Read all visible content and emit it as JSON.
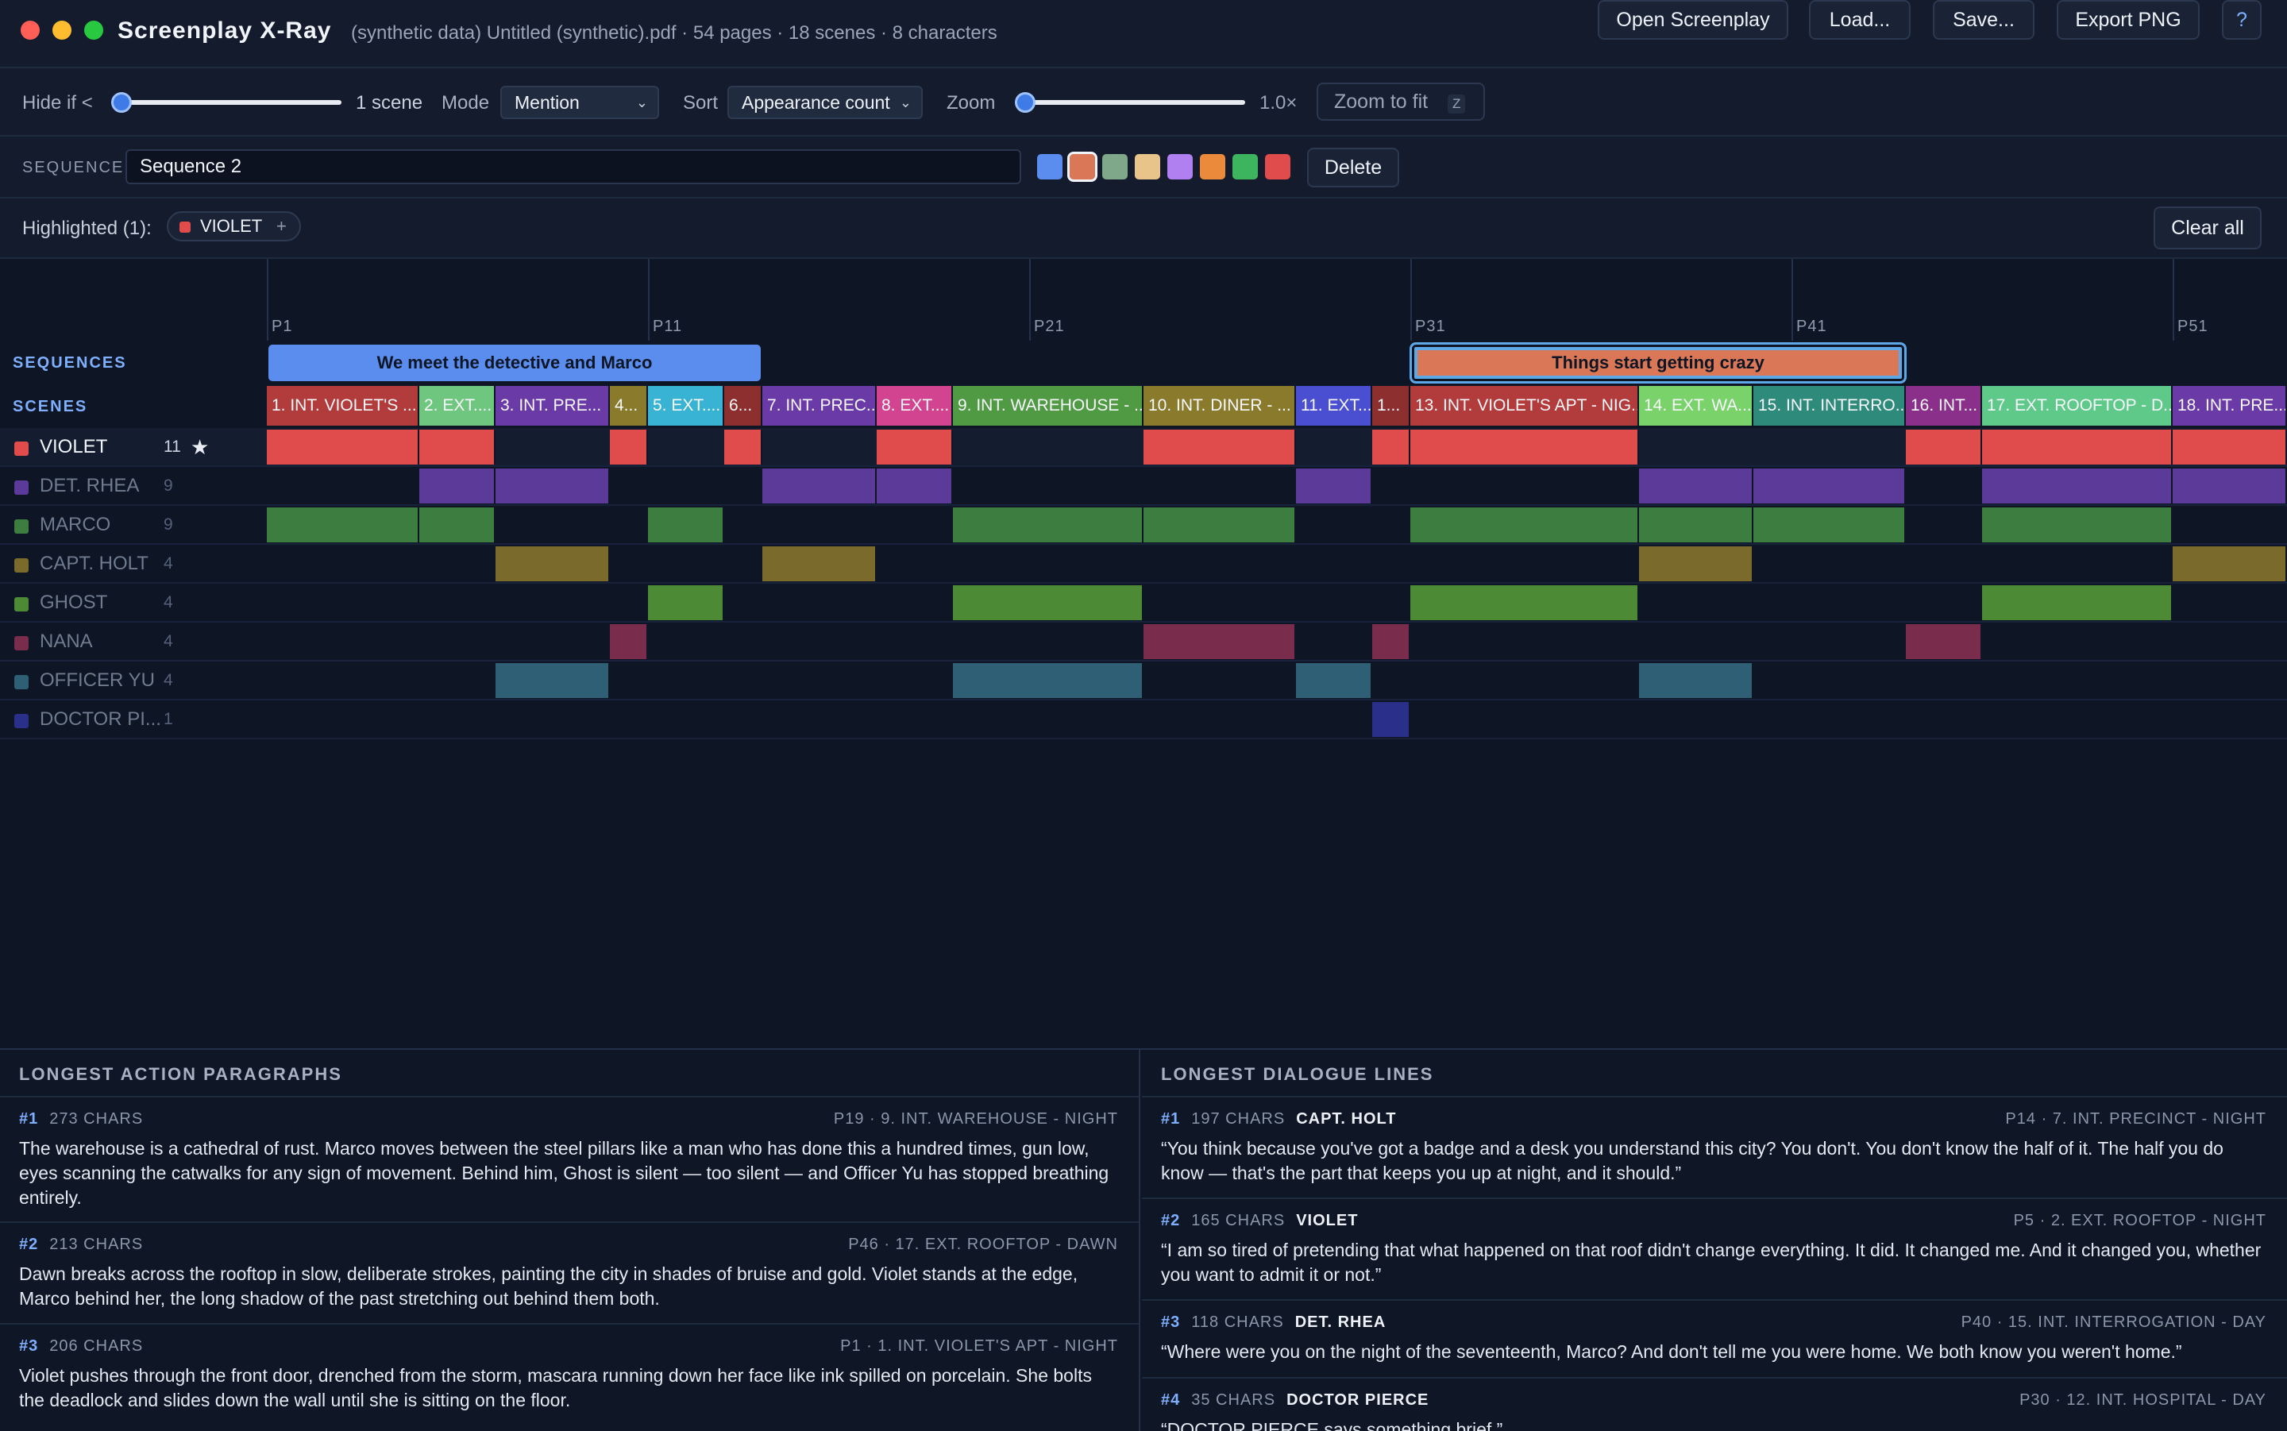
{
  "app": {
    "title": "Screenplay X-Ray",
    "file_info": "(synthetic data) Untitled (synthetic).pdf · 54 pages · 18 scenes · 8 characters"
  },
  "toolbar": {
    "open": "Open Screenplay",
    "load": "Load...",
    "save": "Save...",
    "export": "Export PNG",
    "help": "?"
  },
  "controls": {
    "hide_label": "Hide if <",
    "hide_value": "1 scene",
    "mode_label": "Mode",
    "mode_value": "Mention",
    "sort_label": "Sort",
    "sort_value": "Appearance count",
    "zoom_label": "Zoom",
    "zoom_value": "1.0×",
    "zoom_fit": "Zoom to fit",
    "zoom_fit_key": "Z"
  },
  "sequence_editor": {
    "label": "SEQUENCE",
    "name": "Sequence 2",
    "delete": "Delete",
    "swatches": [
      "#5b8def",
      "#d97757",
      "#7fa88a",
      "#e9c48a",
      "#b07ff0",
      "#ea8a3a",
      "#3db55e",
      "#e04b4b"
    ],
    "selected_swatch": 1
  },
  "highlight": {
    "label": "Highlighted (1):",
    "chip": "VIOLET",
    "chip_color": "#e04b4b",
    "add": "+",
    "clear": "Clear all"
  },
  "timeline": {
    "page_ticks": [
      "P1",
      "P11",
      "P21",
      "P31",
      "P41",
      "P51"
    ],
    "sequences_label": "SEQUENCES",
    "scenes_label": "SCENES",
    "sequences": [
      {
        "label": "We meet the detective and Marco",
        "color": "#5b8def",
        "scene_start": 1,
        "scene_end": 6
      },
      {
        "label": "Things start getting crazy",
        "color": "#d97757",
        "scene_start": 13,
        "scene_end": 15
      }
    ],
    "scenes": [
      {
        "label": "1. INT. VIOLET'S ...",
        "color": "#b23b3b",
        "w": 2
      },
      {
        "label": "2. EXT....",
        "color": "#6fc67e",
        "w": 1
      },
      {
        "label": "3. INT. PRE...",
        "color": "#6a3aa6",
        "w": 1.5
      },
      {
        "label": "4...",
        "color": "#8a7a2c",
        "w": 0.5
      },
      {
        "label": "5. EXT....",
        "color": "#39b3d3",
        "w": 1
      },
      {
        "label": "6...",
        "color": "#8e2f2f",
        "w": 0.5
      },
      {
        "label": "7. INT. PREC...",
        "color": "#6a3aa6",
        "w": 1.5
      },
      {
        "label": "8. EXT....",
        "color": "#d2448f",
        "w": 1
      },
      {
        "label": "9. INT. WAREHOUSE - ...",
        "color": "#4f9a42",
        "w": 2.5
      },
      {
        "label": "10. INT. DINER - ...",
        "color": "#8a7a2c",
        "w": 2
      },
      {
        "label": "11. EXT....",
        "color": "#4a4fd2",
        "w": 1
      },
      {
        "label": "1...",
        "color": "#8e2f2f",
        "w": 0.5
      },
      {
        "label": "13. INT. VIOLET'S APT - NIG...",
        "color": "#b23b3b",
        "w": 3
      },
      {
        "label": "14. EXT. WA...",
        "color": "#7ad36a",
        "w": 1.5
      },
      {
        "label": "15. INT. INTERRO...",
        "color": "#2e8a7a",
        "w": 2
      },
      {
        "label": "16. INT...",
        "color": "#8a2f8a",
        "w": 1
      },
      {
        "label": "17. EXT. ROOFTOP - D...",
        "color": "#5fc98a",
        "w": 2.5
      },
      {
        "label": "18. INT. PRE...",
        "color": "#6a3aa6",
        "w": 1.5
      }
    ],
    "characters": [
      {
        "name": "VIOLET",
        "count": "11",
        "color": "#e04b4b",
        "star": "★",
        "highlighted": true,
        "scenes": [
          0,
          1,
          3,
          5,
          7,
          9,
          11,
          12,
          15,
          16,
          17
        ]
      },
      {
        "name": "DET. RHEA",
        "count": "9",
        "color": "#5b3a9a",
        "scenes": [
          1,
          2,
          6,
          7,
          10,
          13,
          14,
          16,
          17
        ]
      },
      {
        "name": "MARCO",
        "count": "9",
        "color": "#3d7d3f",
        "scenes": [
          0,
          1,
          4,
          8,
          9,
          12,
          13,
          14,
          16
        ]
      },
      {
        "name": "CAPT. HOLT",
        "count": "4",
        "color": "#7a6a2c",
        "scenes": [
          2,
          6,
          13,
          17
        ]
      },
      {
        "name": "GHOST",
        "count": "4",
        "color": "#4c8a36",
        "scenes": [
          4,
          8,
          12,
          16
        ]
      },
      {
        "name": "NANA",
        "count": "4",
        "color": "#7a2c4c",
        "scenes": [
          3,
          9,
          11,
          15
        ]
      },
      {
        "name": "OFFICER YU",
        "count": "4",
        "color": "#2f5f74",
        "scenes": [
          2,
          8,
          10,
          13
        ]
      },
      {
        "name": "DOCTOR PI...",
        "count": "1",
        "color": "#2a2f8a",
        "scenes": [
          11
        ]
      }
    ]
  },
  "action": {
    "title": "LONGEST ACTION PARAGRAPHS",
    "items": [
      {
        "rank": "#1",
        "chars": "273 CHARS",
        "loc": "P19 · 9. INT. WAREHOUSE - NIGHT",
        "text": "The warehouse is a cathedral of rust. Marco moves between the steel pillars like a man who has done this a hundred times, gun low, eyes scanning the catwalks for any sign of movement. Behind him, Ghost is silent — too silent — and Officer Yu has stopped breathing entirely."
      },
      {
        "rank": "#2",
        "chars": "213 CHARS",
        "loc": "P46 · 17. EXT. ROOFTOP - DAWN",
        "text": "Dawn breaks across the rooftop in slow, deliberate strokes, painting the city in shades of bruise and gold. Violet stands at the edge, Marco behind her, the long shadow of the past stretching out behind them both."
      },
      {
        "rank": "#3",
        "chars": "206 CHARS",
        "loc": "P1 · 1. INT. VIOLET'S APT - NIGHT",
        "text": "Violet pushes through the front door, drenched from the storm, mascara running down her face like ink spilled on porcelain. She bolts the deadlock and slides down the wall until she is sitting on the floor."
      }
    ]
  },
  "dialogue": {
    "title": "LONGEST DIALOGUE LINES",
    "items": [
      {
        "rank": "#1",
        "chars": "197 CHARS",
        "who": "CAPT. HOLT",
        "loc": "P14 · 7. INT. PRECINCT - NIGHT",
        "text": "“You think because you've got a badge and a desk you understand this city? You don't. You don't know the half of it. The half you do know — that's the part that keeps you up at night, and it should.”"
      },
      {
        "rank": "#2",
        "chars": "165 CHARS",
        "who": "VIOLET",
        "loc": "P5 · 2. EXT. ROOFTOP - NIGHT",
        "text": "“I am so tired of pretending that what happened on that roof didn't change everything. It did. It changed me. And it changed you, whether you want to admit it or not.”"
      },
      {
        "rank": "#3",
        "chars": "118 CHARS",
        "who": "DET. RHEA",
        "loc": "P40 · 15. INT. INTERROGATION - DAY",
        "text": "“Where were you on the night of the seventeenth, Marco? And don't tell me you were home. We both know you weren't home.”"
      },
      {
        "rank": "#4",
        "chars": "35 CHARS",
        "who": "DOCTOR PIERCE",
        "loc": "P30 · 12. INT. HOSPITAL - DAY",
        "text": "“DOCTOR PIERCE says something brief.”"
      }
    ]
  }
}
